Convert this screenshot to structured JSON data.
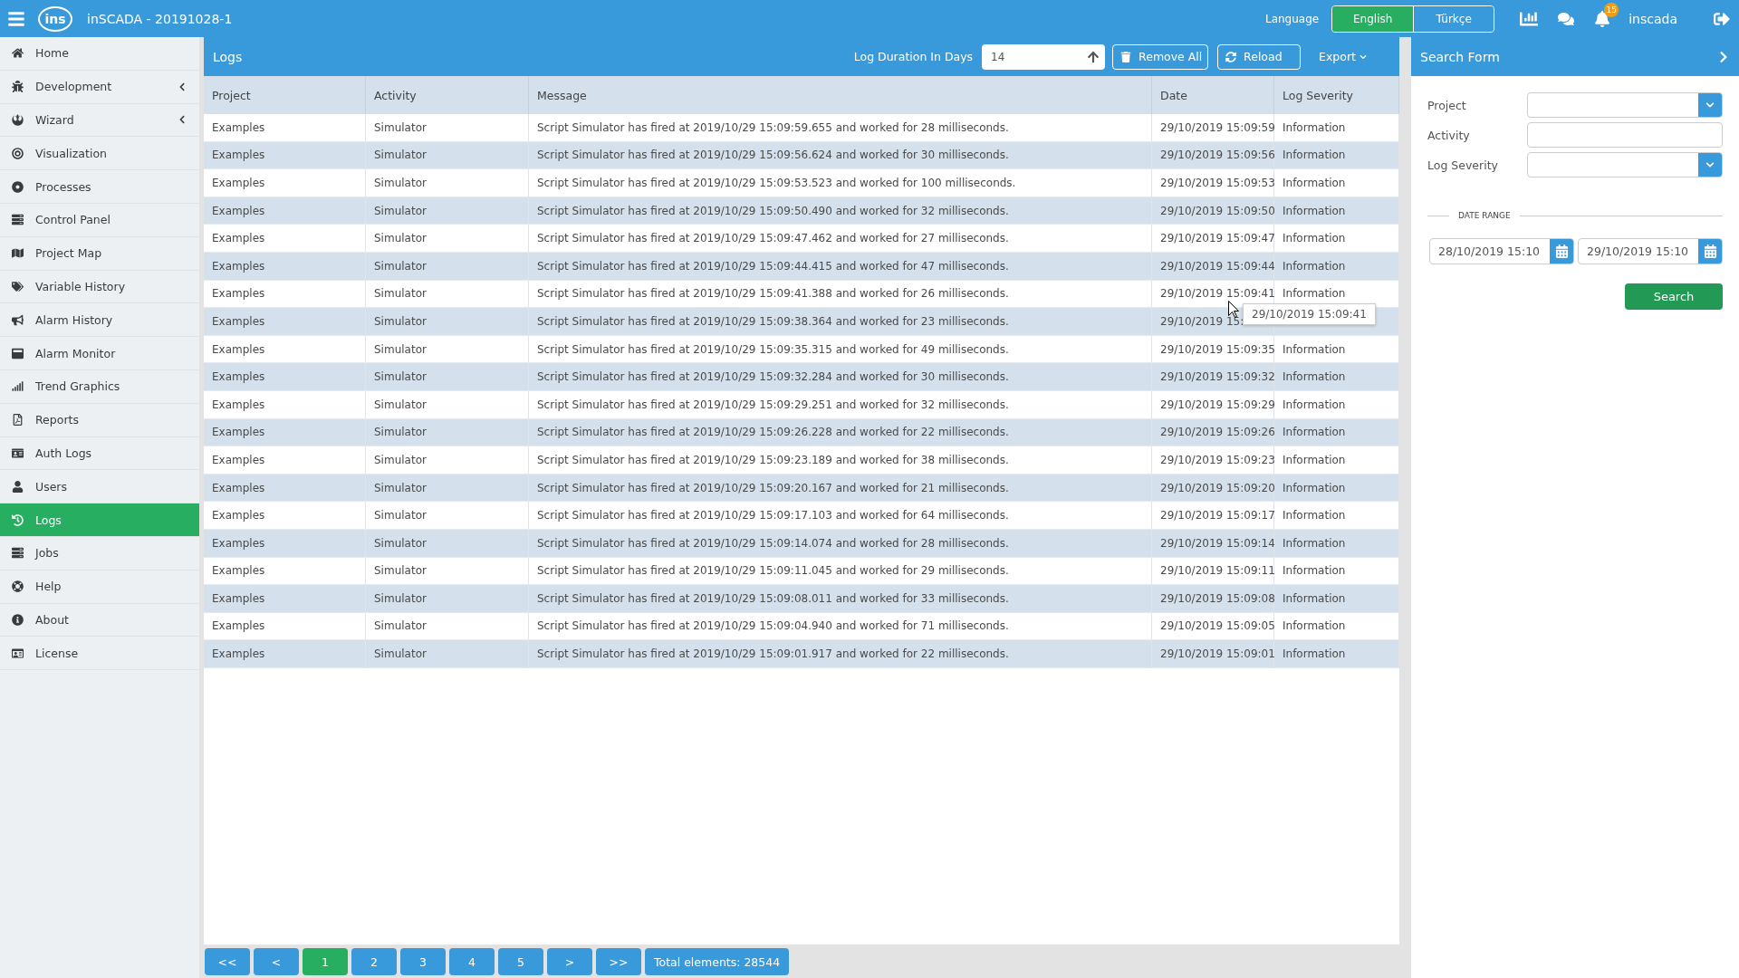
{
  "topbar": {
    "logo_text": "ins",
    "title": "inSCADA - 20191028-1",
    "language_label": "Language",
    "languages": [
      {
        "label": "English",
        "selected": true
      },
      {
        "label": "Türkçe",
        "selected": false
      }
    ],
    "notification_count": "15",
    "user": "inscada"
  },
  "sidebar": {
    "items": [
      {
        "label": "Home",
        "kind": "link",
        "selected": false
      },
      {
        "label": "Development",
        "kind": "group",
        "selected": false
      },
      {
        "label": "Wizard",
        "kind": "group",
        "selected": false
      },
      {
        "label": "Visualization",
        "kind": "link",
        "selected": false
      },
      {
        "label": "Processes",
        "kind": "link",
        "selected": false
      },
      {
        "label": "Control Panel",
        "kind": "link",
        "selected": false
      },
      {
        "label": "Project Map",
        "kind": "link",
        "selected": false
      },
      {
        "label": "Variable History",
        "kind": "link",
        "selected": false
      },
      {
        "label": "Alarm History",
        "kind": "link",
        "selected": false
      },
      {
        "label": "Alarm Monitor",
        "kind": "link",
        "selected": false
      },
      {
        "label": "Trend Graphics",
        "kind": "link",
        "selected": false
      },
      {
        "label": "Reports",
        "kind": "link",
        "selected": false
      },
      {
        "label": "Auth Logs",
        "kind": "link",
        "selected": false
      },
      {
        "label": "Users",
        "kind": "link",
        "selected": false
      },
      {
        "label": "Logs",
        "kind": "link",
        "selected": true
      },
      {
        "label": "Jobs",
        "kind": "link",
        "selected": false
      },
      {
        "label": "Help",
        "kind": "link",
        "selected": false
      },
      {
        "label": "About",
        "kind": "link",
        "selected": false
      },
      {
        "label": "License",
        "kind": "link",
        "selected": false
      }
    ]
  },
  "logs": {
    "title": "Logs",
    "duration_label": "Log Duration In Days",
    "duration_value": "14",
    "buttons": [
      "Remove All",
      "Reload"
    ],
    "export_label": "Export",
    "table": {
      "columns": [
        "Project",
        "Activity",
        "Message",
        "Date",
        "Log Severity"
      ],
      "rows": [
        {
          "project": "Examples",
          "activity": "Simulator",
          "message": "Script Simulator has fired at 2019/10/29 15:09:59.655 and worked for 28 milliseconds.",
          "date": "29/10/2019 15:09:59",
          "severity": "Information"
        },
        {
          "project": "Examples",
          "activity": "Simulator",
          "message": "Script Simulator has fired at 2019/10/29 15:09:56.624 and worked for 30 milliseconds.",
          "date": "29/10/2019 15:09:56",
          "severity": "Information"
        },
        {
          "project": "Examples",
          "activity": "Simulator",
          "message": "Script Simulator has fired at 2019/10/29 15:09:53.523 and worked for 100 milliseconds.",
          "date": "29/10/2019 15:09:53",
          "severity": "Information"
        },
        {
          "project": "Examples",
          "activity": "Simulator",
          "message": "Script Simulator has fired at 2019/10/29 15:09:50.490 and worked for 32 milliseconds.",
          "date": "29/10/2019 15:09:50",
          "severity": "Information"
        },
        {
          "project": "Examples",
          "activity": "Simulator",
          "message": "Script Simulator has fired at 2019/10/29 15:09:47.462 and worked for 27 milliseconds.",
          "date": "29/10/2019 15:09:47",
          "severity": "Information"
        },
        {
          "project": "Examples",
          "activity": "Simulator",
          "message": "Script Simulator has fired at 2019/10/29 15:09:44.415 and worked for 47 milliseconds.",
          "date": "29/10/2019 15:09:44",
          "severity": "Information"
        },
        {
          "project": "Examples",
          "activity": "Simulator",
          "message": "Script Simulator has fired at 2019/10/29 15:09:41.388 and worked for 26 milliseconds.",
          "date": "29/10/2019 15:09:41",
          "severity": "Information",
          "tooltip": "29/10/2019 15:09:41"
        },
        {
          "project": "Examples",
          "activity": "Simulator",
          "message": "Script Simulator has fired at 2019/10/29 15:09:38.364 and worked for 23 milliseconds.",
          "date": "29/10/2019 15:"
        },
        {
          "project": "Examples",
          "activity": "Simulator",
          "message": "Script Simulator has fired at 2019/10/29 15:09:35.315 and worked for 49 milliseconds.",
          "date": "29/10/2019 15:09:35",
          "severity": "Information"
        },
        {
          "project": "Examples",
          "activity": "Simulator",
          "message": "Script Simulator has fired at 2019/10/29 15:09:32.284 and worked for 30 milliseconds.",
          "date": "29/10/2019 15:09:32",
          "severity": "Information"
        },
        {
          "project": "Examples",
          "activity": "Simulator",
          "message": "Script Simulator has fired at 2019/10/29 15:09:29.251 and worked for 32 milliseconds.",
          "date": "29/10/2019 15:09:29",
          "severity": "Information"
        },
        {
          "project": "Examples",
          "activity": "Simulator",
          "message": "Script Simulator has fired at 2019/10/29 15:09:26.228 and worked for 22 milliseconds.",
          "date": "29/10/2019 15:09:26",
          "severity": "Information"
        },
        {
          "project": "Examples",
          "activity": "Simulator",
          "message": "Script Simulator has fired at 2019/10/29 15:09:23.189 and worked for 38 milliseconds.",
          "date": "29/10/2019 15:09:23",
          "severity": "Information"
        },
        {
          "project": "Examples",
          "activity": "Simulator",
          "message": "Script Simulator has fired at 2019/10/29 15:09:20.167 and worked for 21 milliseconds.",
          "date": "29/10/2019 15:09:20",
          "severity": "Information"
        },
        {
          "project": "Examples",
          "activity": "Simulator",
          "message": "Script Simulator has fired at 2019/10/29 15:09:17.103 and worked for 64 milliseconds.",
          "date": "29/10/2019 15:09:17",
          "severity": "Information"
        },
        {
          "project": "Examples",
          "activity": "Simulator",
          "message": "Script Simulator has fired at 2019/10/29 15:09:14.074 and worked for 28 milliseconds.",
          "date": "29/10/2019 15:09:14",
          "severity": "Information"
        },
        {
          "project": "Examples",
          "activity": "Simulator",
          "message": "Script Simulator has fired at 2019/10/29 15:09:11.045 and worked for 29 milliseconds.",
          "date": "29/10/2019 15:09:11",
          "severity": "Information"
        },
        {
          "project": "Examples",
          "activity": "Simulator",
          "message": "Script Simulator has fired at 2019/10/29 15:09:08.011 and worked for 33 milliseconds.",
          "date": "29/10/2019 15:09:08",
          "severity": "Information"
        },
        {
          "project": "Examples",
          "activity": "Simulator",
          "message": "Script Simulator has fired at 2019/10/29 15:09:04.940 and worked for 71 milliseconds.",
          "date": "29/10/2019 15:09:05",
          "severity": "Information"
        },
        {
          "project": "Examples",
          "activity": "Simulator",
          "message": "Script Simulator has fired at 2019/10/29 15:09:01.917 and worked for 22 milliseconds.",
          "date": "29/10/2019 15:09:01",
          "severity": "Information"
        }
      ]
    },
    "pagination": {
      "pages": [
        {
          "label": "<<",
          "selected": false
        },
        {
          "label": "<",
          "selected": false
        },
        {
          "label": "1",
          "selected": true
        },
        {
          "label": "2",
          "selected": false
        },
        {
          "label": "3",
          "selected": false
        },
        {
          "label": "4",
          "selected": false
        },
        {
          "label": "5",
          "selected": false
        },
        {
          "label": ">",
          "selected": false
        },
        {
          "label": ">>",
          "selected": false
        }
      ],
      "total": "Total elements: 28544"
    }
  },
  "search_form": {
    "title": "Search Form",
    "fields": [
      {
        "label": "Project",
        "kind": "select"
      },
      {
        "label": "Activity",
        "kind": "text"
      },
      {
        "label": "Log Severity",
        "kind": "select"
      }
    ],
    "date_range_label": "DATE RANGE",
    "date_from": "28/10/2019 15:10",
    "date_to": "29/10/2019 15:10",
    "search_button": "Search"
  }
}
